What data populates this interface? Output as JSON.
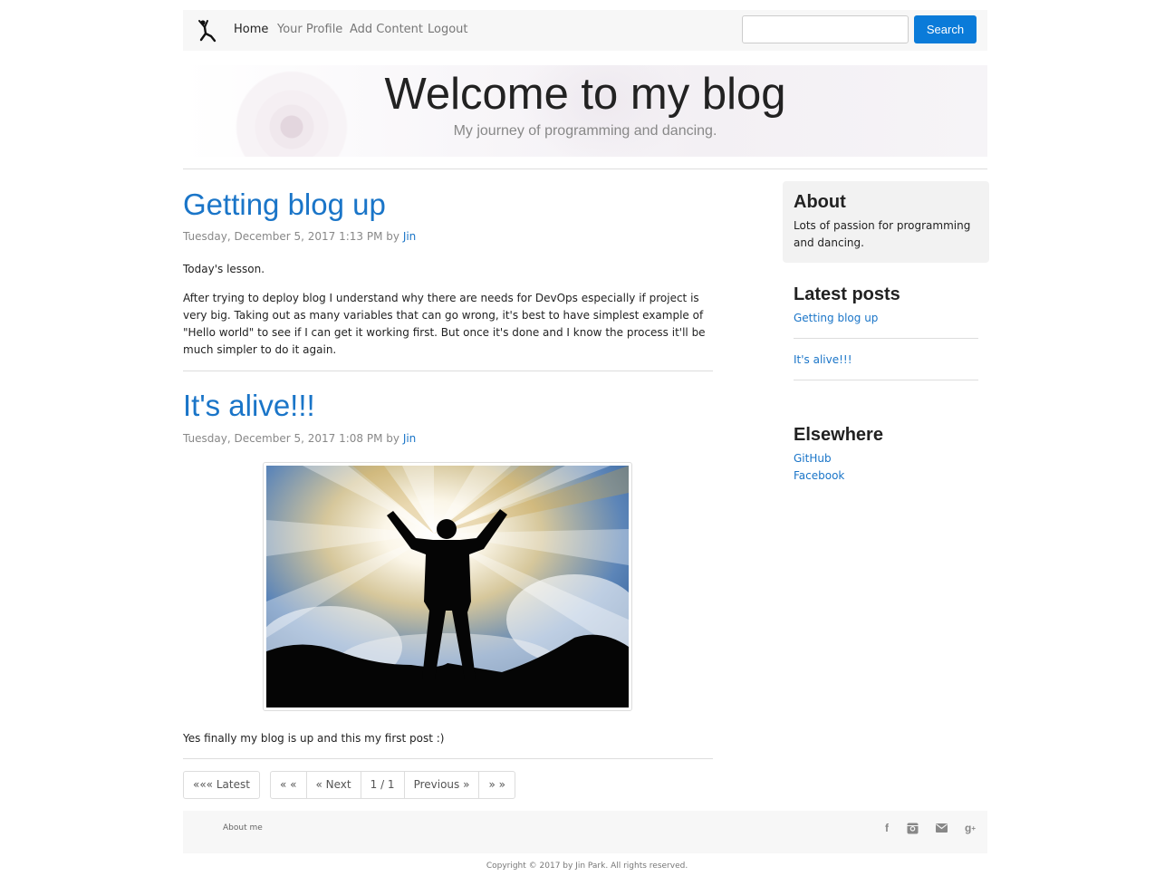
{
  "nav": {
    "links": [
      "Home",
      "Your Profile",
      "Add Content",
      "Logout"
    ],
    "search_placeholder": "",
    "search_button": "Search"
  },
  "hero": {
    "title": "Welcome to my blog",
    "subtitle": "My journey of programming and dancing."
  },
  "posts": [
    {
      "title": "Getting blog up",
      "meta_prefix": "Tuesday, December 5, 2017 1:13 PM by ",
      "author": "Jin",
      "paragraphs": [
        "Today's lesson.",
        "After trying to deploy blog I understand why there are needs for DevOps especially if project is very big. Taking out as many variables that can go wrong, it's best to have simplest example of \"Hello world\" to see if I can get it working first. But once it's done and I know the process it'll be much simpler to do it again."
      ]
    },
    {
      "title": "It's alive!!!",
      "meta_prefix": "Tuesday, December 5, 2017 1:08 PM by ",
      "author": "Jin",
      "paragraphs": [
        "Yes finally my blog is up and this my first post :)"
      ]
    }
  ],
  "pager": {
    "latest": "««« Latest",
    "first": "« «",
    "next": "« Next",
    "page": "1 / 1",
    "previous": "Previous »",
    "last": "» »"
  },
  "sidebar": {
    "about_heading": "About",
    "about_text": "Lots of passion for programming and dancing.",
    "latest_heading": "Latest posts",
    "latest_posts": [
      "Getting blog up",
      "It's alive!!!"
    ],
    "elsewhere_heading": "Elsewhere",
    "elsewhere_links": [
      "GitHub",
      "Facebook"
    ]
  },
  "footer": {
    "about_link": "About me",
    "icons": [
      "facebook-icon",
      "instagram-icon",
      "mail-icon",
      "google-plus-icon"
    ],
    "copyright": "Copyright © 2017 by Jin Park. All rights reserved."
  },
  "colors": {
    "accent": "#1a75c8",
    "button": "#0a7bd9"
  }
}
